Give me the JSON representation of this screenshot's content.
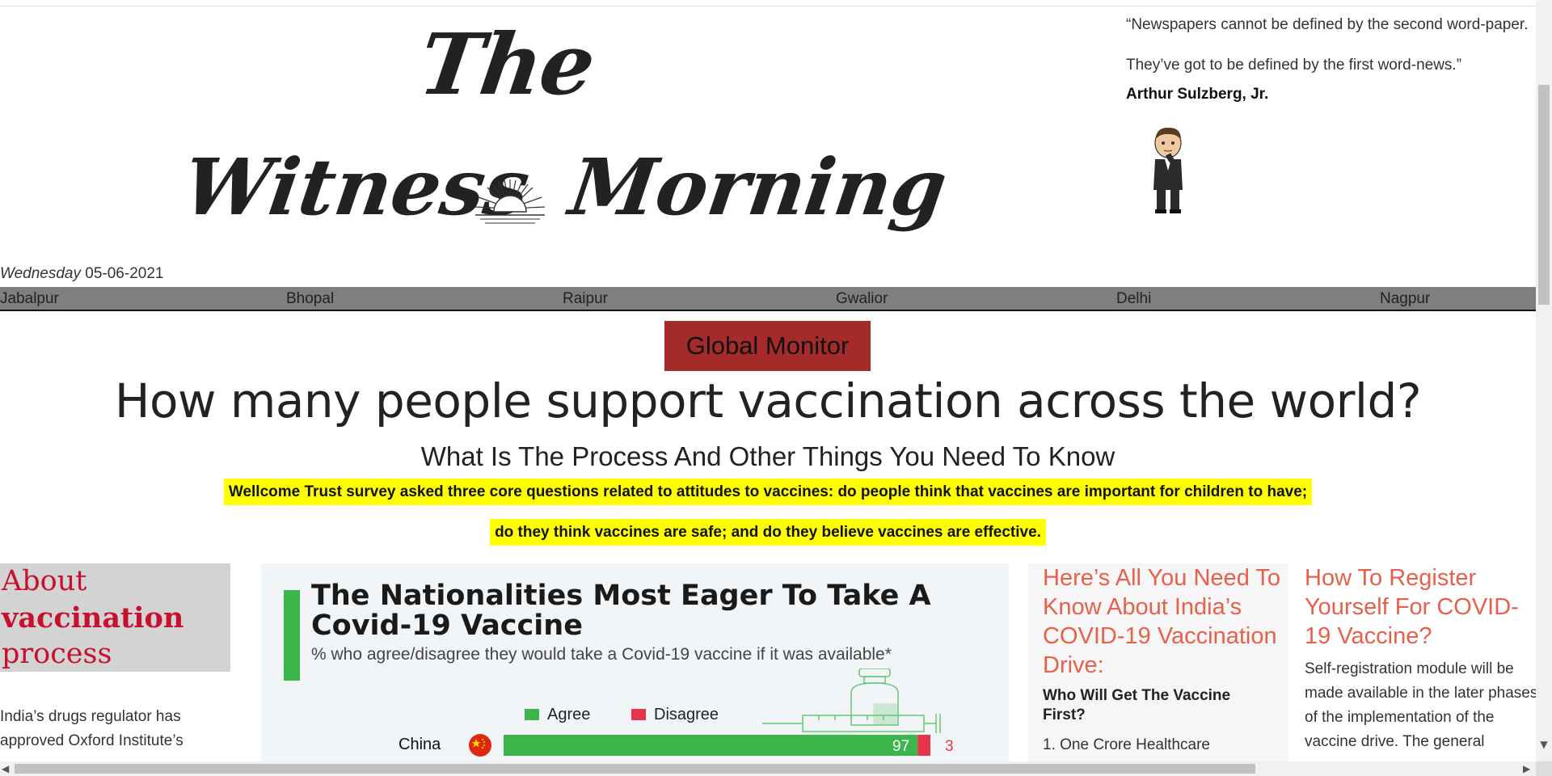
{
  "masthead": {
    "line1": "The",
    "line2_left": "Witness",
    "line2_right": "Morning",
    "sun_icon": "rising-sun-icon"
  },
  "quote": {
    "text": "“Newspapers cannot be defined by the second word-paper. They’ve got to be defined by the first word-news.”",
    "author": "Arthur Sulzberg, Jr.",
    "image": "thinking-man-cartoon"
  },
  "date": {
    "day": "Wednesday",
    "value": "05-06-2021"
  },
  "cities": [
    "Jabalpur",
    "Bhopal",
    "Raipur",
    "Gwalior",
    "Delhi",
    "Nagpur"
  ],
  "section_badge": "Global Monitor",
  "headline": "How many people support vaccination across the world?",
  "subheadline": "What Is The Process And Other Things You Need To Know",
  "highlight": {
    "line1": "Wellcome Trust survey asked three core questions related to attitudes to vaccines: do people think that vaccines are important for children to have;",
    "line2": "do they think vaccines are safe; and do they believe vaccines are effective."
  },
  "about": {
    "word1": "About",
    "word2": "vaccination",
    "word3": "process",
    "text": "India’s drugs regulator has approved Oxford Institute’s"
  },
  "infographic": {
    "title": "The Nationalities Most Eager To Take A Covid-19 Vaccine",
    "subtitle": "% who agree/disagree they would take a Covid-19 vaccine if it was available*",
    "legend_agree": "Agree",
    "legend_disagree": "Disagree",
    "vaccine_icon": "syringe-vial-icon",
    "flag_icon": "china-flag-icon",
    "colors": {
      "agree": "#3cb64a",
      "disagree": "#e8344a"
    }
  },
  "chart_data": {
    "type": "bar",
    "categories": [
      "China"
    ],
    "series": [
      {
        "name": "Agree",
        "values": [
          97
        ]
      },
      {
        "name": "Disagree",
        "values": [
          3
        ]
      }
    ],
    "title": "The Nationalities Most Eager To Take A Covid-19 Vaccine",
    "subtitle": "% who agree/disagree they would take a Covid-19 vaccine if it was available*",
    "legend": "top",
    "xlim": [
      0,
      100
    ]
  },
  "column3": {
    "title": "Here’s All You Need To Know About India’s COVID-19 Vaccination Drive:",
    "subtitle": "Who Will Get The Vaccine First?",
    "item1": "1. One Crore Healthcare"
  },
  "column4": {
    "title": "How To Register Yourself For COVID-19 Vaccine?",
    "text": "Self-registration module will be made available in the later phases of the implementation of the vaccine drive. The general"
  }
}
